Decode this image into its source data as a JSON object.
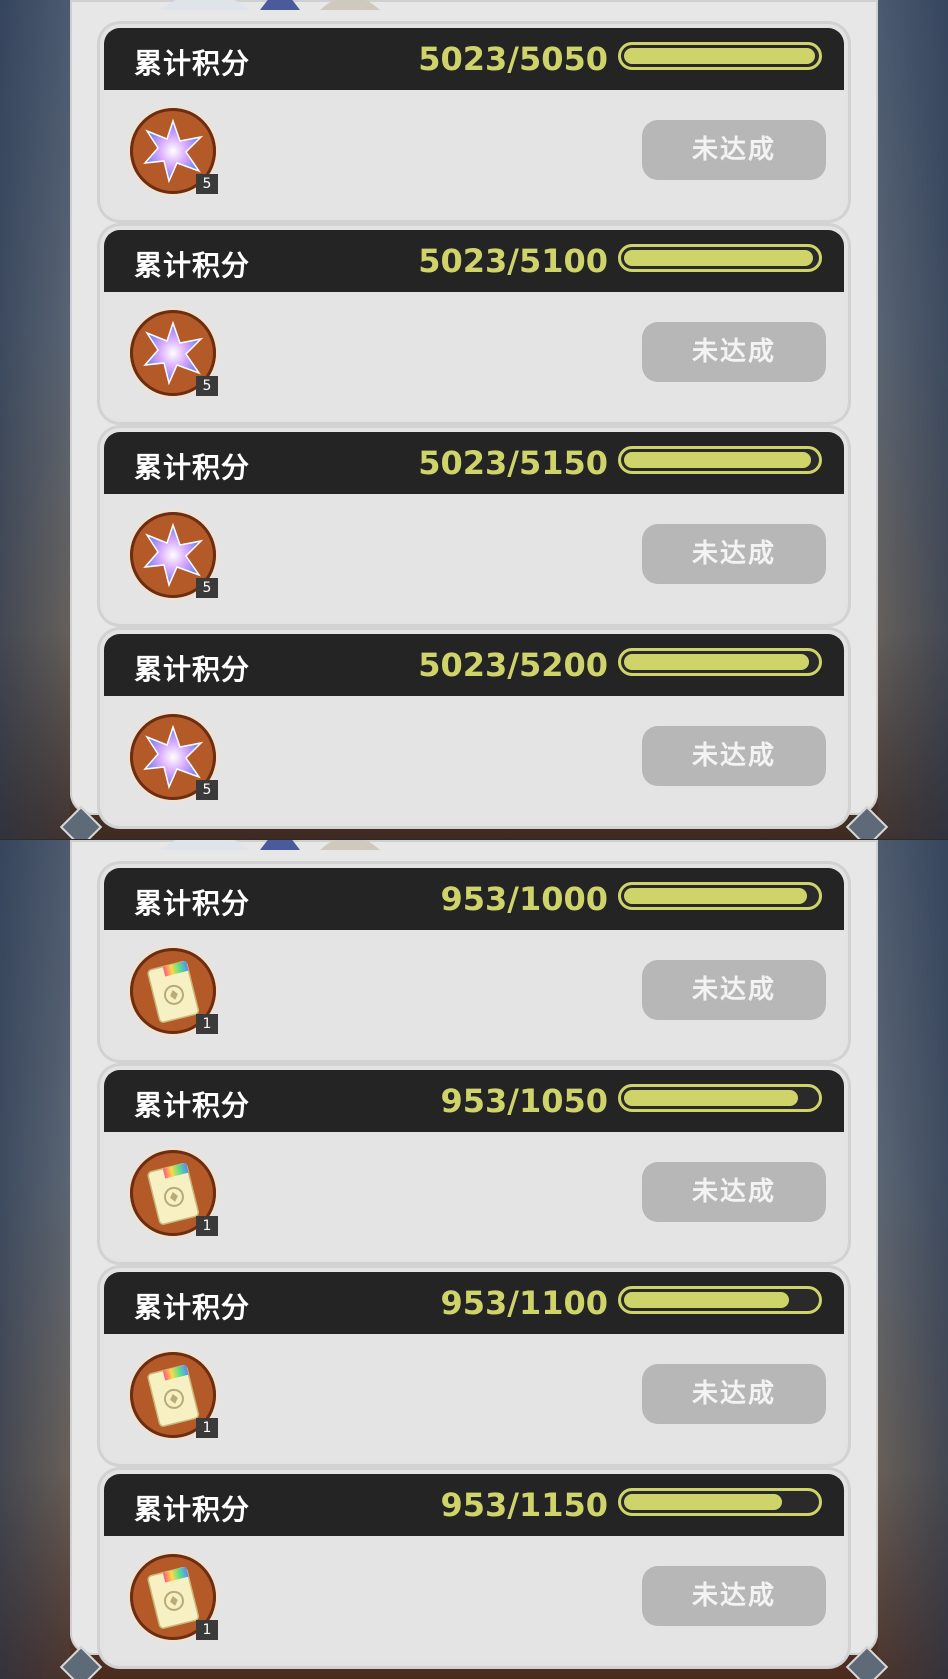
{
  "sections": [
    {
      "cards": [
        {
          "label": "累计积分",
          "progress_text": "5023/5050",
          "progress": 0.995,
          "reward_icon": "star-crystal-icon",
          "reward_qty": "5",
          "status": "未达成"
        },
        {
          "label": "累计积分",
          "progress_text": "5023/5100",
          "progress": 0.985,
          "reward_icon": "star-crystal-icon",
          "reward_qty": "5",
          "status": "未达成"
        },
        {
          "label": "累计积分",
          "progress_text": "5023/5150",
          "progress": 0.975,
          "reward_icon": "star-crystal-icon",
          "reward_qty": "5",
          "status": "未达成"
        },
        {
          "label": "累计积分",
          "progress_text": "5023/5200",
          "progress": 0.966,
          "reward_icon": "star-crystal-icon",
          "reward_qty": "5",
          "status": "未达成"
        }
      ]
    },
    {
      "cards": [
        {
          "label": "累计积分",
          "progress_text": "953/1000",
          "progress": 0.953,
          "reward_icon": "ticket-icon",
          "reward_qty": "1",
          "status": "未达成"
        },
        {
          "label": "累计积分",
          "progress_text": "953/1050",
          "progress": 0.908,
          "reward_icon": "ticket-icon",
          "reward_qty": "1",
          "status": "未达成"
        },
        {
          "label": "累计积分",
          "progress_text": "953/1100",
          "progress": 0.866,
          "reward_icon": "ticket-icon",
          "reward_qty": "1",
          "status": "未达成"
        },
        {
          "label": "累计积分",
          "progress_text": "953/1150",
          "progress": 0.829,
          "reward_icon": "ticket-icon",
          "reward_qty": "1",
          "status": "未达成"
        }
      ]
    }
  ],
  "colors": {
    "accent": "#cfd46a",
    "header_bg": "#242424",
    "button_disabled": "#b7b7b7"
  }
}
